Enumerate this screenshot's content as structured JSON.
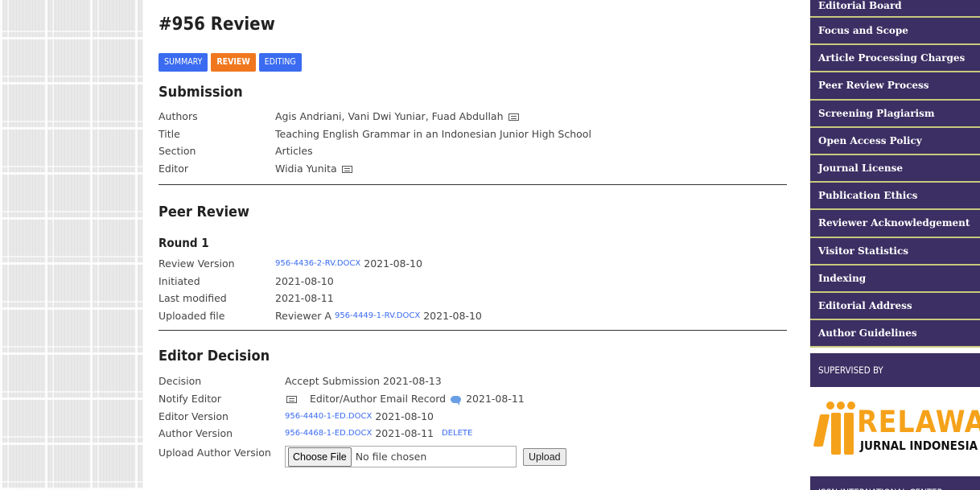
{
  "page": {
    "title": "#956 Review"
  },
  "tabs": [
    {
      "label": "SUMMARY"
    },
    {
      "label": "REVIEW"
    },
    {
      "label": "EDITING"
    }
  ],
  "submission": {
    "title": "Submission",
    "rows": [
      {
        "label": "Authors",
        "value": "Agis Andriani, Vani Dwi Yuniar, Fuad Abdullah"
      },
      {
        "label": "Title",
        "value": "Teaching English Grammar in an Indonesian Junior High School"
      },
      {
        "label": "Section",
        "value": "Articles"
      },
      {
        "label": "Editor",
        "value": "Widia Yunita"
      }
    ]
  },
  "peer_review": {
    "title": "Peer Review",
    "round": "Round 1",
    "rows": [
      {
        "label": "Review Version",
        "file": "956-4436-2-RV.DOCX",
        "date": "2021-08-10"
      },
      {
        "label": "Initiated",
        "value": "2021-08-10"
      },
      {
        "label": "Last modified",
        "value": "2021-08-11"
      },
      {
        "label": "Uploaded file",
        "prefix": "Reviewer A",
        "file": "956-4449-1-RV.DOCX",
        "date": "2021-08-10"
      }
    ]
  },
  "editor_decision": {
    "title": "Editor Decision",
    "decision_label": "Decision",
    "decision_value": "Accept Submission 2021-08-13",
    "notify_label": "Notify Editor",
    "notify_link": "Editor/Author Email Record",
    "notify_date": "2021-08-11",
    "editor_version_label": "Editor Version",
    "editor_version_file": "956-4440-1-ED.DOCX",
    "editor_version_date": "2021-08-10",
    "author_version_label": "Author Version",
    "author_version_file": "956-4468-1-ED.DOCX",
    "author_version_date": "2021-08-11",
    "delete_label": "DELETE",
    "upload_label": "Upload Author Version",
    "choose_file_label": "Choose File",
    "no_file_text": "No file chosen",
    "upload_button": "Upload"
  },
  "sidebar": {
    "items": [
      {
        "label": "Editorial Board"
      },
      {
        "label": "Focus and Scope"
      },
      {
        "label": "Article Processing Charges"
      },
      {
        "label": "Peer Review Process"
      },
      {
        "label": "Screening Plagiarism"
      },
      {
        "label": "Open Access Policy"
      },
      {
        "label": "Journal License"
      },
      {
        "label": "Publication Ethics"
      },
      {
        "label": "Reviewer Acknowledgement"
      },
      {
        "label": "Visitor Statistics"
      },
      {
        "label": "Indexing"
      },
      {
        "label": "Editorial Address"
      },
      {
        "label": "Author Guidelines"
      }
    ],
    "supervised_by": "SUPERVISED BY",
    "logo_main": "RELAWAN",
    "logo_sub": "JURNAL INDONESIA",
    "footer": "ISSN INTERNATIONAL CENTER"
  },
  "colors": {
    "tab_blue": "#3a6bf0",
    "tab_orange": "#f0771e",
    "sidebar_bg": "#3b2f63",
    "sidebar_border": "#c9c97d",
    "logo_orange": "#f5a21a"
  }
}
